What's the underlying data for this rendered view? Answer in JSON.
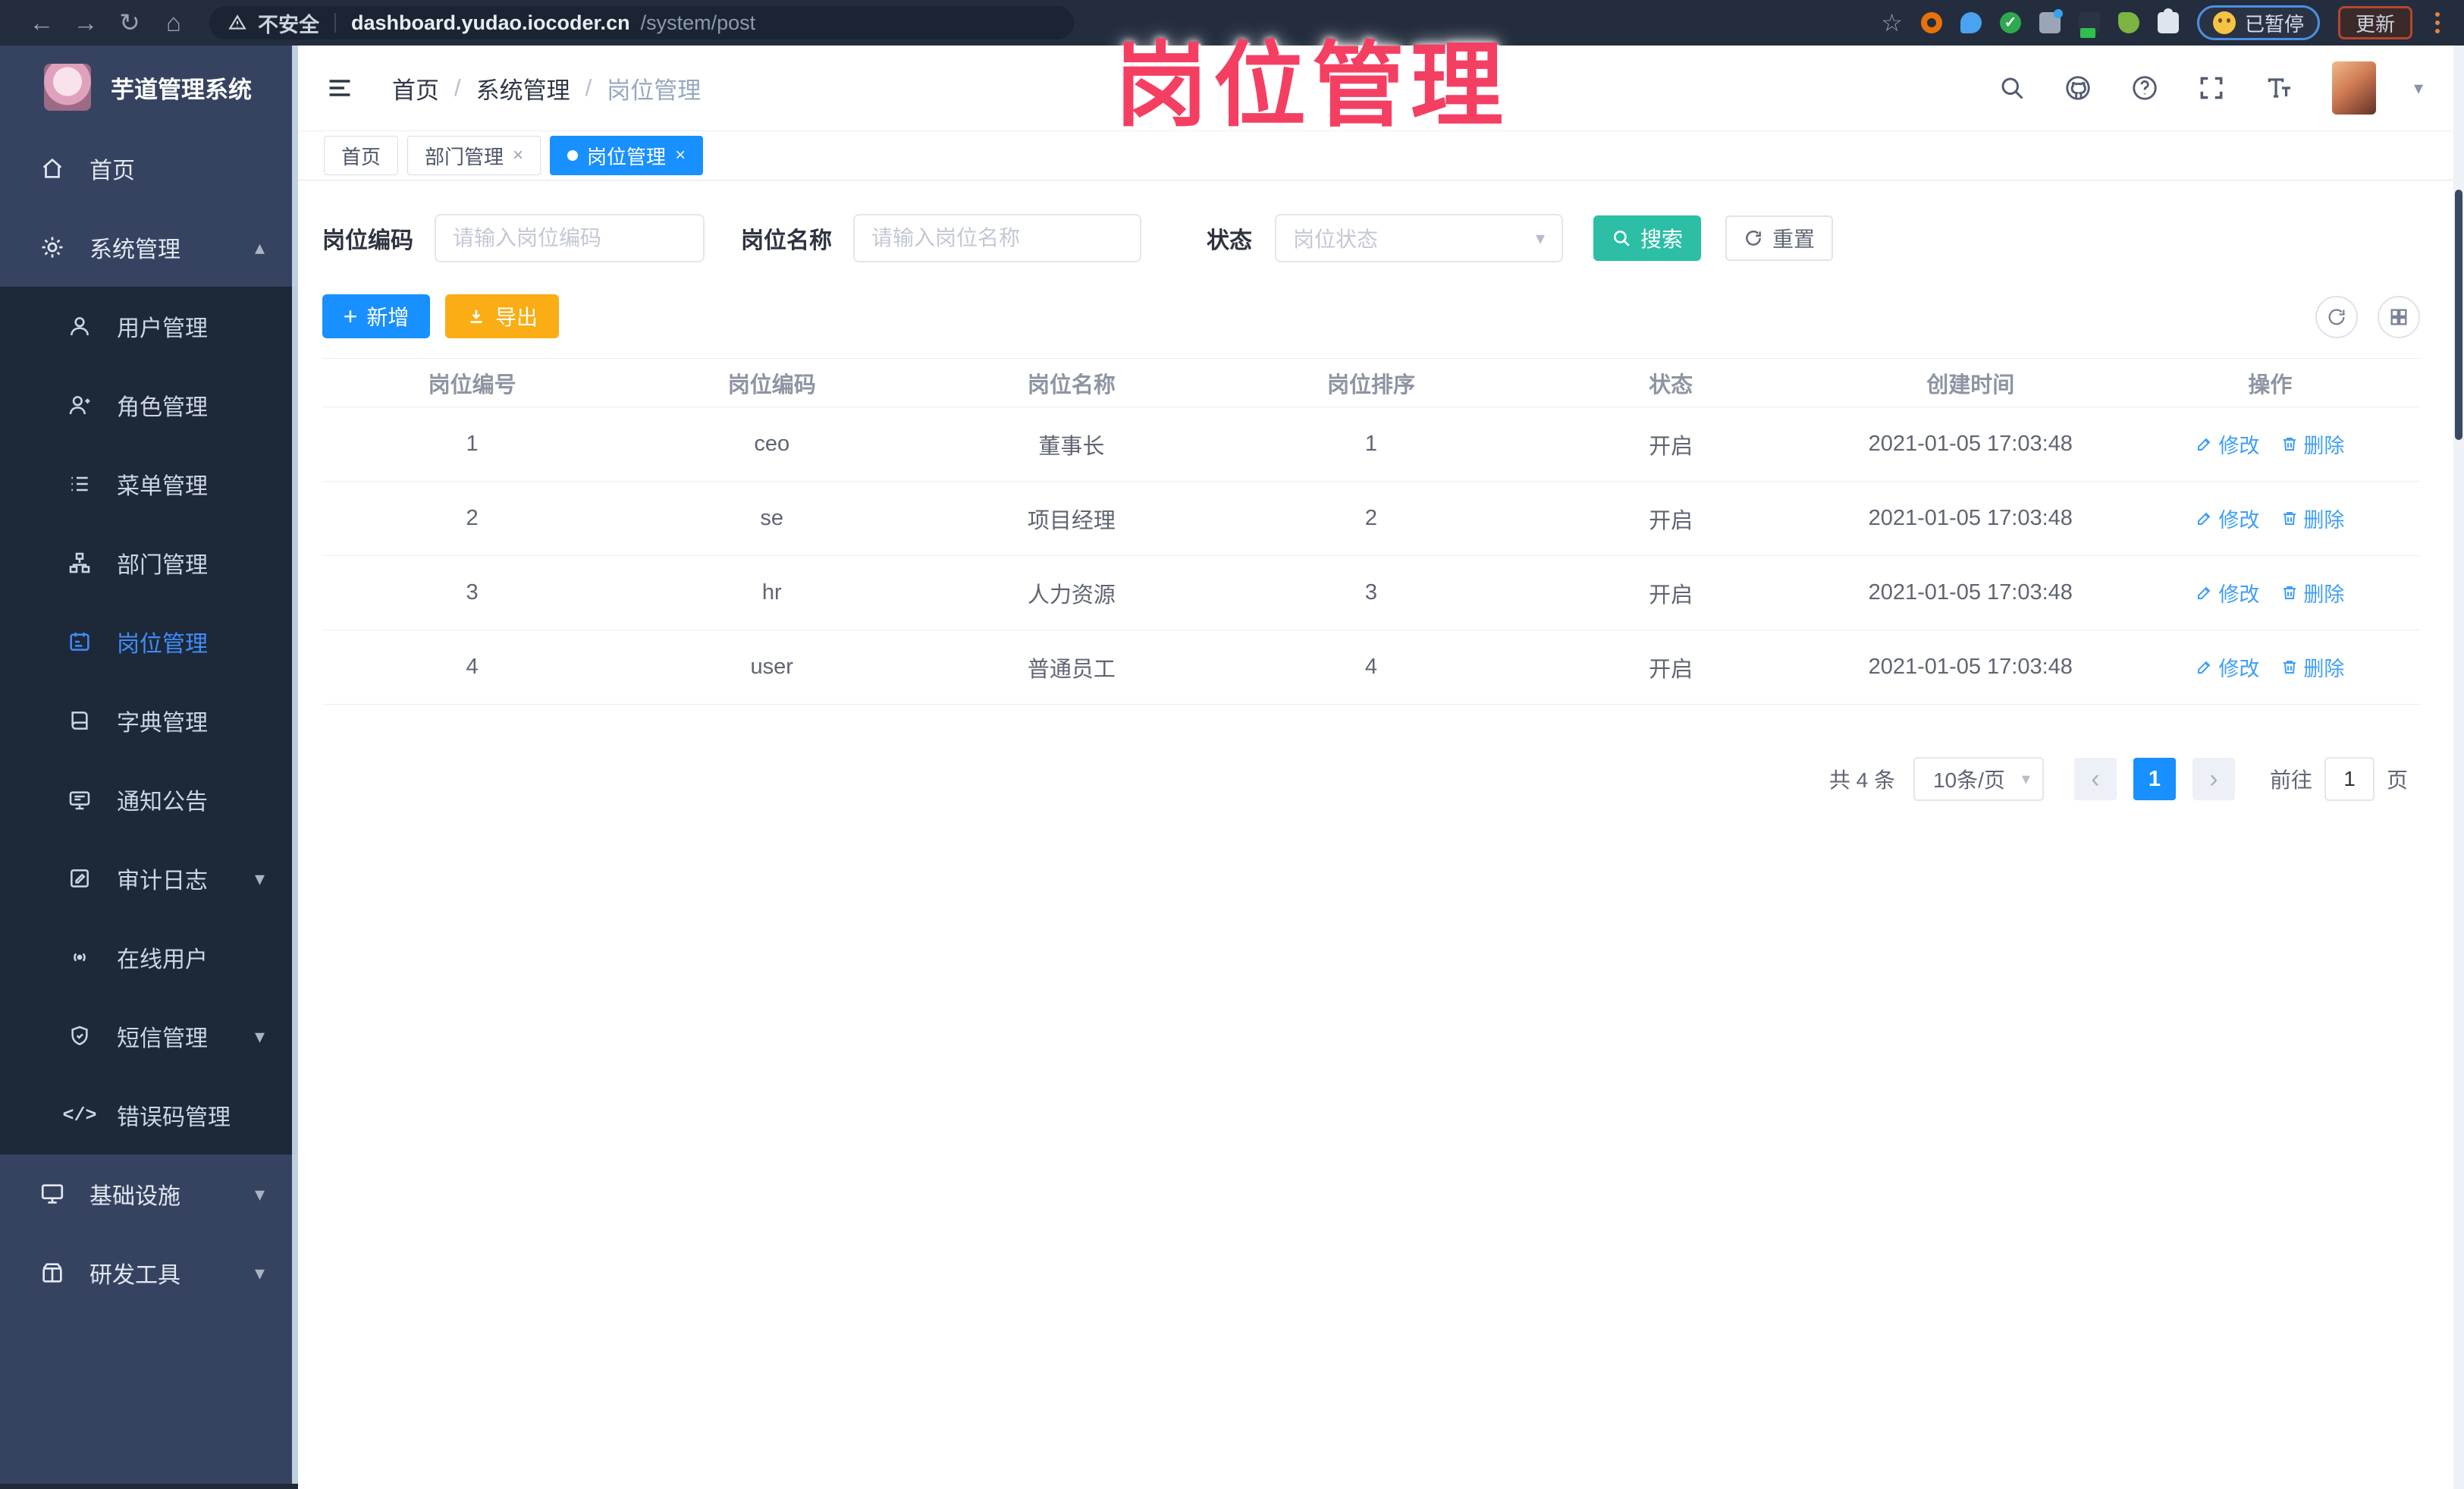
{
  "overlay_title": "岗位管理",
  "browser": {
    "security_label": "不安全",
    "url_host": "dashboard.yudao.iocoder.cn",
    "url_path": "/system/post",
    "paused_badge": "已暂停",
    "update_button": "更新"
  },
  "sidebar": {
    "logo_title": "芋道管理系统",
    "menu": [
      {
        "label": "首页",
        "icon": "home-icon",
        "level": 1,
        "arrow": "",
        "active": false
      },
      {
        "label": "系统管理",
        "icon": "gear-icon",
        "level": 1,
        "arrow": "up",
        "active": false
      },
      {
        "label": "用户管理",
        "icon": "user-icon",
        "level": 2,
        "arrow": "",
        "active": false
      },
      {
        "label": "角色管理",
        "icon": "role-icon",
        "level": 2,
        "arrow": "",
        "active": false
      },
      {
        "label": "菜单管理",
        "icon": "menu-list-icon",
        "level": 2,
        "arrow": "",
        "active": false
      },
      {
        "label": "部门管理",
        "icon": "org-tree-icon",
        "level": 2,
        "arrow": "",
        "active": false
      },
      {
        "label": "岗位管理",
        "icon": "post-icon",
        "level": 2,
        "arrow": "",
        "active": true
      },
      {
        "label": "字典管理",
        "icon": "dict-icon",
        "level": 2,
        "arrow": "",
        "active": false
      },
      {
        "label": "通知公告",
        "icon": "notice-icon",
        "level": 2,
        "arrow": "",
        "active": false
      },
      {
        "label": "审计日志",
        "icon": "audit-icon",
        "level": 2,
        "arrow": "down",
        "active": false
      },
      {
        "label": "在线用户",
        "icon": "online-icon",
        "level": 2,
        "arrow": "",
        "active": false
      },
      {
        "label": "短信管理",
        "icon": "sms-icon",
        "level": 2,
        "arrow": "down",
        "active": false
      },
      {
        "label": "错误码管理",
        "icon": "error-code-icon",
        "level": 2,
        "arrow": "",
        "active": false
      },
      {
        "label": "基础设施",
        "icon": "infra-icon",
        "level": 1,
        "arrow": "down",
        "active": false
      },
      {
        "label": "研发工具",
        "icon": "tools-icon",
        "level": 1,
        "arrow": "down",
        "active": false
      }
    ]
  },
  "header": {
    "breadcrumb": [
      "首页",
      "系统管理",
      "岗位管理"
    ]
  },
  "tabs": [
    {
      "label": "首页",
      "active": false,
      "closable": false,
      "dot": false
    },
    {
      "label": "部门管理",
      "active": false,
      "closable": true,
      "dot": false
    },
    {
      "label": "岗位管理",
      "active": true,
      "closable": true,
      "dot": true
    }
  ],
  "filters": {
    "code_label": "岗位编码",
    "code_placeholder": "请输入岗位编码",
    "name_label": "岗位名称",
    "name_placeholder": "请输入岗位名称",
    "status_label": "状态",
    "status_placeholder": "岗位状态",
    "search_label": "搜索",
    "reset_label": "重置"
  },
  "toolbar": {
    "add_label": "新增",
    "export_label": "导出"
  },
  "table": {
    "columns": [
      "岗位编号",
      "岗位编码",
      "岗位名称",
      "岗位排序",
      "状态",
      "创建时间",
      "操作"
    ],
    "rows": [
      {
        "id": "1",
        "code": "ceo",
        "name": "董事长",
        "sort": "1",
        "status": "开启",
        "created": "2021-01-05 17:03:48"
      },
      {
        "id": "2",
        "code": "se",
        "name": "项目经理",
        "sort": "2",
        "status": "开启",
        "created": "2021-01-05 17:03:48"
      },
      {
        "id": "3",
        "code": "hr",
        "name": "人力资源",
        "sort": "3",
        "status": "开启",
        "created": "2021-01-05 17:03:48"
      },
      {
        "id": "4",
        "code": "user",
        "name": "普通员工",
        "sort": "4",
        "status": "开启",
        "created": "2021-01-05 17:03:48"
      }
    ],
    "edit_label": "修改",
    "delete_label": "删除"
  },
  "pagination": {
    "total": "共 4 条",
    "page_size": "10条/页",
    "current_page": "1",
    "goto_label": "前往",
    "goto_value": "1",
    "page_unit": "页"
  },
  "colors": {
    "accent_blue": "#1890ff",
    "teal": "#2cbfa5",
    "orange": "#faad14",
    "link_blue": "#3f9ef8",
    "overlay_pink": "#f43f63",
    "sidebar_bg": "#364360",
    "submenu_bg": "#1d2838"
  }
}
